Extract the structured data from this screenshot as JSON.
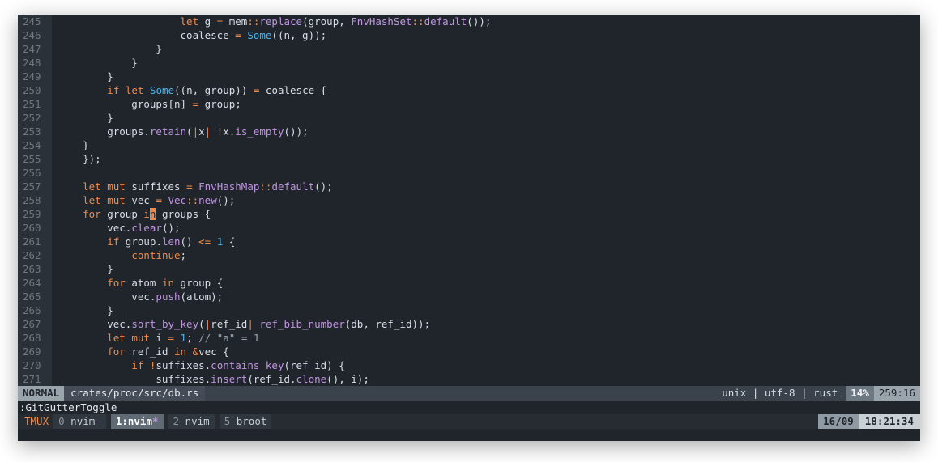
{
  "editor": {
    "lines": [
      {
        "n": "245"
      },
      {
        "n": "246"
      },
      {
        "n": "247"
      },
      {
        "n": "248"
      },
      {
        "n": "249"
      },
      {
        "n": "250"
      },
      {
        "n": "251"
      },
      {
        "n": "252"
      },
      {
        "n": "253"
      },
      {
        "n": "254"
      },
      {
        "n": "255"
      },
      {
        "n": "256"
      },
      {
        "n": "257"
      },
      {
        "n": "258"
      },
      {
        "n": "259"
      },
      {
        "n": "260"
      },
      {
        "n": "261"
      },
      {
        "n": "262"
      },
      {
        "n": "263"
      },
      {
        "n": "264"
      },
      {
        "n": "265"
      },
      {
        "n": "266"
      },
      {
        "n": "267"
      },
      {
        "n": "268"
      },
      {
        "n": "269"
      },
      {
        "n": "270"
      },
      {
        "n": "271"
      }
    ],
    "code": {
      "l245": [
        "                    ",
        "let",
        " g ",
        "=",
        " mem",
        "::",
        "replace",
        "(group, ",
        "FnvHashSet",
        "::",
        "default",
        "());"
      ],
      "l246": [
        "                    coalesce ",
        "=",
        " ",
        "Some",
        "((n, g));"
      ],
      "l247": [
        "                }"
      ],
      "l248": [
        "            }"
      ],
      "l249": [
        "        }"
      ],
      "l250": [
        "        ",
        "if",
        " ",
        "let",
        " ",
        "Some",
        "((n, group)) ",
        "=",
        " coalesce {"
      ],
      "l251": [
        "            groups[n] ",
        "=",
        " group;"
      ],
      "l252": [
        "        }"
      ],
      "l253": [
        "        groups.",
        "retain",
        "(",
        "|",
        "x",
        "|",
        " ",
        "!",
        "x.",
        "is_empty",
        "());"
      ],
      "l254": [
        "    }"
      ],
      "l255": [
        "    });"
      ],
      "l256": [
        ""
      ],
      "l257": [
        "    ",
        "let",
        " ",
        "mut",
        " suffixes ",
        "=",
        " ",
        "FnvHashMap",
        "::",
        "default",
        "();"
      ],
      "l258": [
        "    ",
        "let",
        " ",
        "mut",
        " vec ",
        "=",
        " ",
        "Vec",
        "::",
        "new",
        "();"
      ],
      "l259": [
        "    ",
        "for",
        " group ",
        "i",
        "n",
        " groups {"
      ],
      "l260": [
        "        vec.",
        "clear",
        "();"
      ],
      "l261": [
        "        ",
        "if",
        " group.",
        "len",
        "() ",
        "<=",
        " ",
        "1",
        " {"
      ],
      "l262": [
        "            ",
        "continue",
        ";"
      ],
      "l263": [
        "        }"
      ],
      "l264": [
        "        ",
        "for",
        " atom ",
        "in",
        " group {"
      ],
      "l265": [
        "            vec.",
        "push",
        "(atom);"
      ],
      "l266": [
        "        }"
      ],
      "l267": [
        "        vec.",
        "sort_by_key",
        "(",
        "|",
        "ref_id",
        "|",
        " ",
        "ref_bib_number",
        "(db, ref_id));"
      ],
      "l268": [
        "        ",
        "let",
        " ",
        "mut",
        " i ",
        "=",
        " ",
        "1",
        "; ",
        "// \"a\" = 1"
      ],
      "l269": [
        "        ",
        "for",
        " ref_id ",
        "in",
        " ",
        "&",
        "vec {"
      ],
      "l270": [
        "            ",
        "if",
        " ",
        "!",
        "suffixes.",
        "contains_key",
        "(ref_id) {"
      ],
      "l271": [
        "                suffixes.",
        "insert",
        "(ref_id.",
        "clone",
        "(), i);"
      ]
    },
    "cursor": {
      "line": 259,
      "col": 16
    }
  },
  "statusline": {
    "mode": "NORMAL",
    "file": "crates/proc/src/db.rs",
    "format": "unix",
    "encoding": "utf-8",
    "filetype": "rust",
    "sep": "|",
    "percent": "14%",
    "position": "259:16"
  },
  "cmdline": ":GitGutterToggle",
  "tmux": {
    "label": "TMUX",
    "windows": [
      {
        "idx": "0",
        "name": "nvim",
        "flag": "-",
        "active": false
      },
      {
        "idx": "1",
        "name": "nvim",
        "flag": "*",
        "active": true
      },
      {
        "idx": "2",
        "name": "nvim",
        "flag": "",
        "active": false
      },
      {
        "idx": "5",
        "name": "broot",
        "flag": "",
        "active": false
      }
    ],
    "date": "16/09",
    "time": "18:21:34"
  },
  "colors": {
    "background": "#1f252b",
    "keyword": "#ef8a4a",
    "type": "#c194e0",
    "constructor": "#4fb3e8",
    "cursor": "#ef8a4a"
  }
}
